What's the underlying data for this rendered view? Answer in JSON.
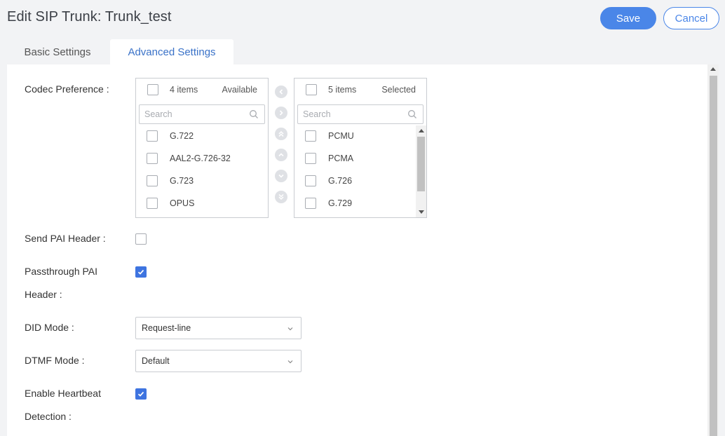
{
  "header": {
    "title": "Edit SIP Trunk: Trunk_test",
    "save_label": "Save",
    "cancel_label": "Cancel"
  },
  "tabs": [
    {
      "label": "Basic Settings",
      "active": false
    },
    {
      "label": "Advanced Settings",
      "active": true
    }
  ],
  "codec": {
    "label": "Codec Preference :",
    "available": {
      "count_label": "4 items",
      "title": "Available",
      "search_placeholder": "Search",
      "items": [
        "G.722",
        "AAL2-G.726-32",
        "G.723",
        "OPUS"
      ]
    },
    "selected": {
      "count_label": "5 items",
      "title": "Selected",
      "search_placeholder": "Search",
      "items": [
        "PCMU",
        "PCMA",
        "G.726",
        "G.729"
      ]
    },
    "transfer_icons": [
      "chevron-left-icon",
      "chevron-right-icon",
      "double-chevron-up-icon",
      "chevron-up-icon",
      "chevron-down-icon",
      "double-chevron-down-icon"
    ]
  },
  "fields": {
    "send_pai": {
      "label": "Send PAI Header :",
      "checked": false
    },
    "passthrough_pai": {
      "label_line1": "Passthrough PAI",
      "label_line2": "Header :",
      "checked": true
    },
    "did_mode": {
      "label": "DID Mode :",
      "value": "Request-line"
    },
    "dtmf_mode": {
      "label": "DTMF Mode :",
      "value": "Default"
    },
    "heartbeat": {
      "label_line1": "Enable Heartbeat",
      "label_line2": "Detection :",
      "checked": true
    }
  },
  "colors": {
    "accent": "#4a86e8",
    "checkbox_checked": "#3e74e0",
    "active_tab_text": "#3a72c8"
  }
}
